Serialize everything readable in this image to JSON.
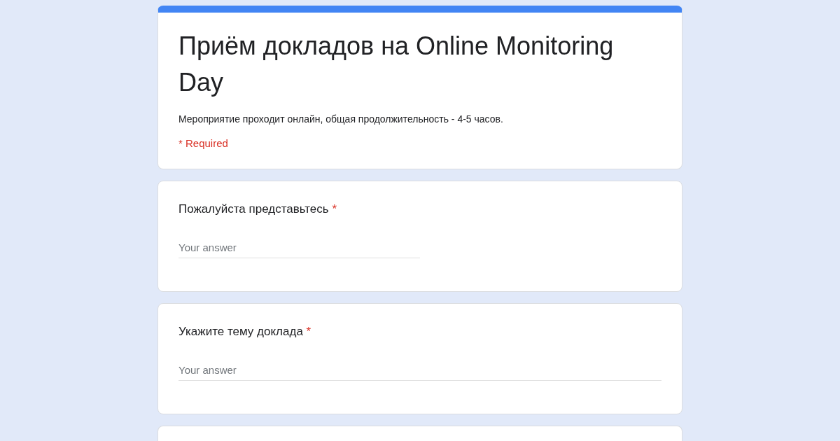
{
  "form": {
    "title": "Приём докладов на Online Monitoring Day",
    "description": "Мероприятие проходит онлайн, общая продолжительность - 4-5 часов.",
    "required_note": "* Required"
  },
  "questions": [
    {
      "kind": "short",
      "label": "Пожалуйста представьтесь",
      "required_mark": "*",
      "placeholder": "Your answer"
    },
    {
      "kind": "paragraph",
      "label": "Укажите тему доклада",
      "required_mark": "*",
      "placeholder": "Your answer"
    }
  ],
  "next_card": {
    "partially_visible": true
  }
}
